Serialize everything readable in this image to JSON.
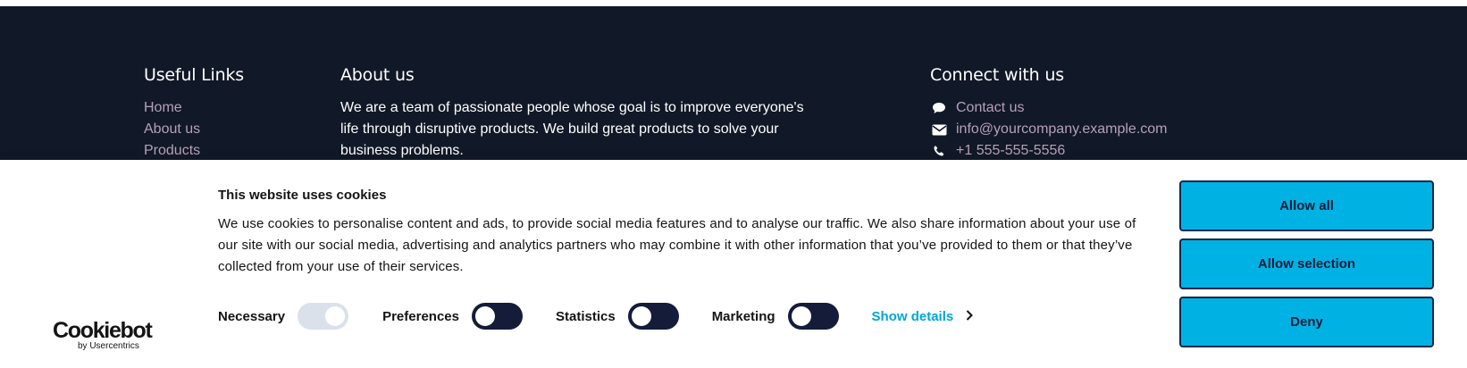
{
  "footer": {
    "useful_links": {
      "heading": "Useful Links",
      "items": [
        "Home",
        "About us",
        "Products"
      ]
    },
    "about": {
      "heading": "About us",
      "text": "We are a team of passionate people whose goal is to improve everyone's life through disruptive products. We build great products to solve your business problems."
    },
    "connect": {
      "heading": "Connect with us",
      "contact_label": "Contact us",
      "email": "info@yourcompany.example.com",
      "phone": "+1 555-555-5556"
    }
  },
  "cookie_banner": {
    "logo": {
      "word": "Cookiebot",
      "sub": "by Usercentrics"
    },
    "title": "This website uses cookies",
    "text": "We use cookies to personalise content and ads, to provide social media features and to analyse our traffic. We also share information about your use of our site with our social media, advertising and analytics partners who may combine it with other information that you’ve provided to them or that they’ve collected from your use of their services.",
    "toggles": {
      "necessary": "Necessary",
      "preferences": "Preferences",
      "statistics": "Statistics",
      "marketing": "Marketing"
    },
    "show_details": "Show details",
    "buttons": {
      "allow_all": "Allow all",
      "allow_selection": "Allow selection",
      "deny": "Deny"
    },
    "colors": {
      "accent": "#00b2e3",
      "toggle_on": "#141c3a",
      "footer_bg": "#111827",
      "link": "#b6a0b8"
    }
  }
}
